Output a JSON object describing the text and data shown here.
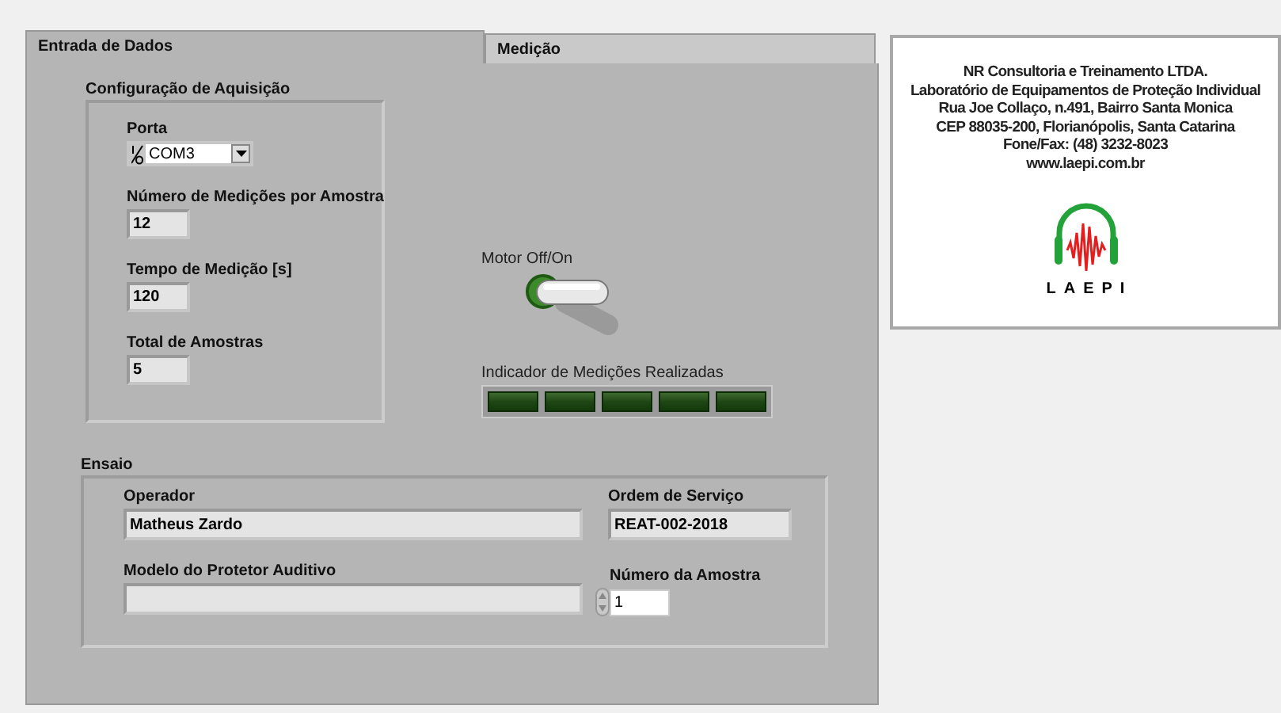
{
  "tabs": [
    {
      "label": "Entrada de Dados",
      "selected": true
    },
    {
      "label": "Medição",
      "selected": false
    }
  ],
  "acquisition": {
    "title": "Configuração de Aquisição",
    "port": {
      "label": "Porta",
      "value": "COM3"
    },
    "fields": [
      {
        "label": "Número de Medições por Amostra",
        "value": "12"
      },
      {
        "label": "Tempo de Medição [s]",
        "value": "120"
      },
      {
        "label": "Total de Amostras",
        "value": "5"
      }
    ]
  },
  "motor": {
    "label": "Motor Off/On",
    "on": false
  },
  "indicator": {
    "label": "Indicador de Medições Realizadas",
    "leds": [
      {
        "on": false
      },
      {
        "on": false
      },
      {
        "on": false
      },
      {
        "on": false
      },
      {
        "on": false
      }
    ]
  },
  "test": {
    "title": "Ensaio",
    "operator": {
      "label": "Operador",
      "value": "Matheus Zardo"
    },
    "order": {
      "label": "Ordem de Serviço",
      "value": "REAT-002-2018"
    },
    "model": {
      "label": "Modelo do Protetor Auditivo"
    },
    "sample": {
      "label": "Número da Amostra",
      "value": "1"
    }
  },
  "info": {
    "lines": [
      "NR Consultoria e Treinamento LTDA.",
      "Laboratório de Equipamentos de Proteção Individual",
      "Rua Joe Collaço, n.491, Bairro Santa Monica",
      "CEP 88035-200, Florianópolis, Santa Catarina",
      "Fone/Fax: (48) 3232-8023",
      "www.laepi.com.br"
    ],
    "logo_text": "LAEPI"
  }
}
